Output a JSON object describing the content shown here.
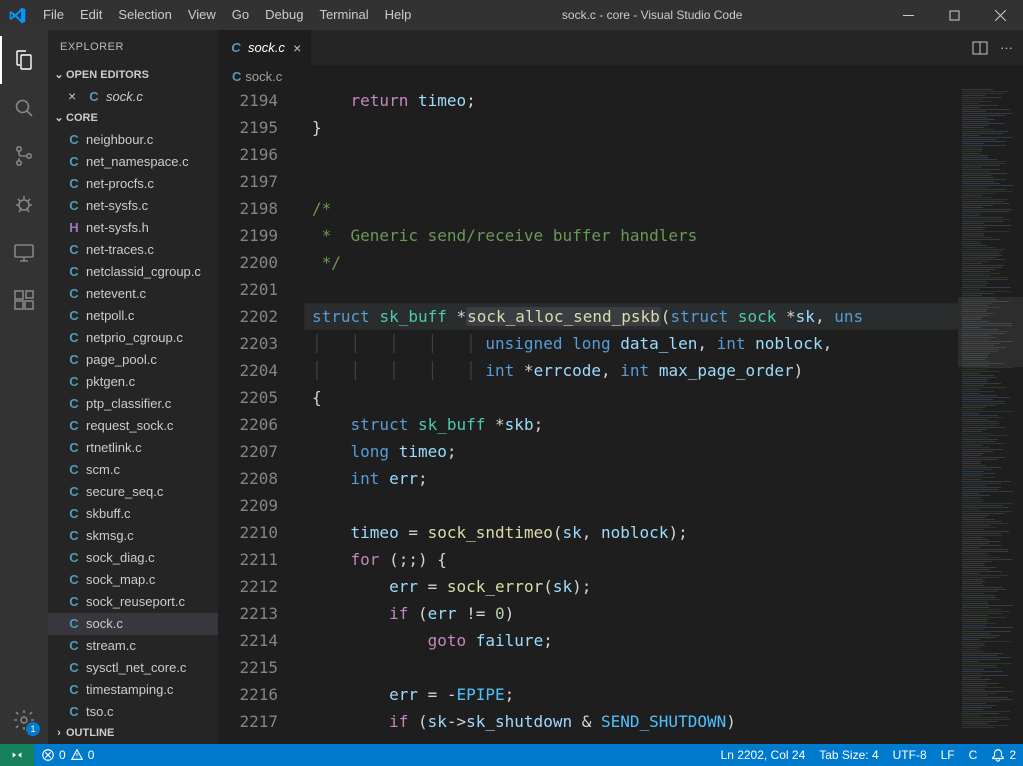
{
  "window": {
    "title": "sock.c - core - Visual Studio Code"
  },
  "menubar": [
    "File",
    "Edit",
    "Selection",
    "View",
    "Go",
    "Debug",
    "Terminal",
    "Help"
  ],
  "activitybar": {
    "items": [
      {
        "name": "explorer",
        "active": true
      },
      {
        "name": "search"
      },
      {
        "name": "source-control"
      },
      {
        "name": "debug"
      },
      {
        "name": "remote"
      },
      {
        "name": "extensions"
      }
    ],
    "bottom": {
      "name": "settings",
      "badge": "1"
    }
  },
  "explorer": {
    "title": "EXPLORER",
    "open_editors": {
      "label": "OPEN EDITORS",
      "items": [
        {
          "name": "sock.c"
        }
      ]
    },
    "folder": {
      "label": "CORE",
      "files": [
        {
          "icon": "C",
          "name": "neighbour.c"
        },
        {
          "icon": "C",
          "name": "net_namespace.c"
        },
        {
          "icon": "C",
          "name": "net-procfs.c"
        },
        {
          "icon": "C",
          "name": "net-sysfs.c"
        },
        {
          "icon": "H",
          "name": "net-sysfs.h"
        },
        {
          "icon": "C",
          "name": "net-traces.c"
        },
        {
          "icon": "C",
          "name": "netclassid_cgroup.c"
        },
        {
          "icon": "C",
          "name": "netevent.c"
        },
        {
          "icon": "C",
          "name": "netpoll.c"
        },
        {
          "icon": "C",
          "name": "netprio_cgroup.c"
        },
        {
          "icon": "C",
          "name": "page_pool.c"
        },
        {
          "icon": "C",
          "name": "pktgen.c"
        },
        {
          "icon": "C",
          "name": "ptp_classifier.c"
        },
        {
          "icon": "C",
          "name": "request_sock.c"
        },
        {
          "icon": "C",
          "name": "rtnetlink.c"
        },
        {
          "icon": "C",
          "name": "scm.c"
        },
        {
          "icon": "C",
          "name": "secure_seq.c"
        },
        {
          "icon": "C",
          "name": "skbuff.c"
        },
        {
          "icon": "C",
          "name": "skmsg.c"
        },
        {
          "icon": "C",
          "name": "sock_diag.c"
        },
        {
          "icon": "C",
          "name": "sock_map.c"
        },
        {
          "icon": "C",
          "name": "sock_reuseport.c"
        },
        {
          "icon": "C",
          "name": "sock.c",
          "active": true
        },
        {
          "icon": "C",
          "name": "stream.c"
        },
        {
          "icon": "C",
          "name": "sysctl_net_core.c"
        },
        {
          "icon": "C",
          "name": "timestamping.c"
        },
        {
          "icon": "C",
          "name": "tso.c"
        }
      ]
    },
    "outline": {
      "label": "OUTLINE"
    }
  },
  "tabs": {
    "open": [
      {
        "name": "sock.c"
      }
    ]
  },
  "breadcrumb": {
    "file": "sock.c"
  },
  "code": {
    "first_line": 2194,
    "lines": [
      {
        "n": 2194,
        "html": "    <span class='tok-ctrl'>return</span> <span class='tok-var'>timeo</span>;"
      },
      {
        "n": 2195,
        "html": "}"
      },
      {
        "n": 2196,
        "html": ""
      },
      {
        "n": 2197,
        "html": ""
      },
      {
        "n": 2198,
        "html": "<span class='tok-cmt'>/*</span>"
      },
      {
        "n": 2199,
        "html": "<span class='tok-cmt'> *  Generic send/receive buffer handlers</span>"
      },
      {
        "n": 2200,
        "html": "<span class='tok-cmt'> */</span>"
      },
      {
        "n": 2201,
        "html": ""
      },
      {
        "n": 2202,
        "hl": true,
        "html": "<span class='tok-kw'>struct</span> <span class='tok-type'>sk_buff</span> *<span class='tok-fn'><span class='selword'>sock_alloc_send_pskb</span></span>(<span class='tok-kw'>struct</span> <span class='tok-type'>sock</span> *<span class='tok-var'>sk</span>, <span class='tok-kw'>uns</span>"
      },
      {
        "n": 2203,
        "html": "<span class='indent-guide'>│   │   │   │   │ </span><span class='tok-kw'>unsigned</span> <span class='tok-kw'>long</span> <span class='tok-var'>data_len</span>, <span class='tok-kw'>int</span> <span class='tok-var'>noblock</span>,"
      },
      {
        "n": 2204,
        "html": "<span class='indent-guide'>│   │   │   │   │ </span><span class='tok-kw'>int</span> *<span class='tok-var'>errcode</span>, <span class='tok-kw'>int</span> <span class='tok-var'>max_page_order</span>)"
      },
      {
        "n": 2205,
        "html": "{"
      },
      {
        "n": 2206,
        "html": "    <span class='tok-kw'>struct</span> <span class='tok-type'>sk_buff</span> *<span class='tok-var'>skb</span>;"
      },
      {
        "n": 2207,
        "html": "    <span class='tok-kw'>long</span> <span class='tok-var'>timeo</span>;"
      },
      {
        "n": 2208,
        "html": "    <span class='tok-kw'>int</span> <span class='tok-var'>err</span>;"
      },
      {
        "n": 2209,
        "html": ""
      },
      {
        "n": 2210,
        "html": "    <span class='tok-var'>timeo</span> = <span class='tok-fn'>sock_sndtimeo</span>(<span class='tok-var'>sk</span>, <span class='tok-var'>noblock</span>);"
      },
      {
        "n": 2211,
        "html": "    <span class='tok-ctrl'>for</span> (;;) {"
      },
      {
        "n": 2212,
        "html": "        <span class='tok-var'>err</span> = <span class='tok-fn'>sock_error</span>(<span class='tok-var'>sk</span>);"
      },
      {
        "n": 2213,
        "html": "        <span class='tok-ctrl'>if</span> (<span class='tok-var'>err</span> != <span class='tok-num'>0</span>)"
      },
      {
        "n": 2214,
        "html": "            <span class='tok-ctrl'>goto</span> <span class='tok-var'>failure</span>;"
      },
      {
        "n": 2215,
        "html": ""
      },
      {
        "n": 2216,
        "html": "        <span class='tok-var'>err</span> = -<span class='tok-const'>EPIPE</span>;"
      },
      {
        "n": 2217,
        "html": "        <span class='tok-ctrl'>if</span> (<span class='tok-var'>sk</span>-><span class='tok-var'>sk_shutdown</span> &amp; <span class='tok-const'>SEND_SHUTDOWN</span>)"
      }
    ]
  },
  "statusbar": {
    "errors": "0",
    "warnings": "0",
    "position": "Ln 2202, Col 24",
    "tabsize": "Tab Size: 4",
    "encoding": "UTF-8",
    "eol": "LF",
    "lang": "C",
    "notifications": "2"
  }
}
